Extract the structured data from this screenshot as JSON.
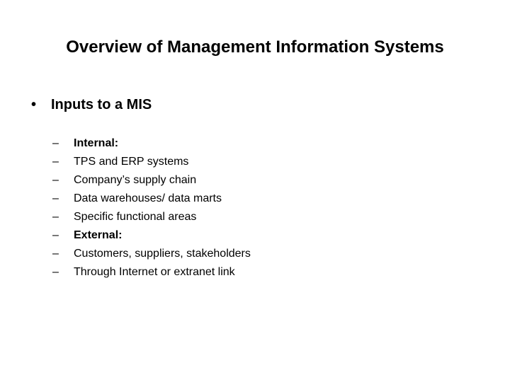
{
  "slide": {
    "title": "Overview of Management Information Systems",
    "bullet": {
      "marker": "•",
      "text": "Inputs to a MIS"
    },
    "sub_marker": "–",
    "sub_items": [
      {
        "text": "Internal:",
        "bold": true
      },
      {
        "text": "TPS and ERP systems",
        "bold": false
      },
      {
        "text": "Company’s supply chain",
        "bold": false
      },
      {
        "text": "Data warehouses/ data marts",
        "bold": false
      },
      {
        "text": "Specific functional areas",
        "bold": false
      },
      {
        "text": "External:",
        "bold": true
      },
      {
        "text": "Customers, suppliers, stakeholders",
        "bold": false
      },
      {
        "text": "Through Internet or extranet link",
        "bold": false
      }
    ]
  }
}
